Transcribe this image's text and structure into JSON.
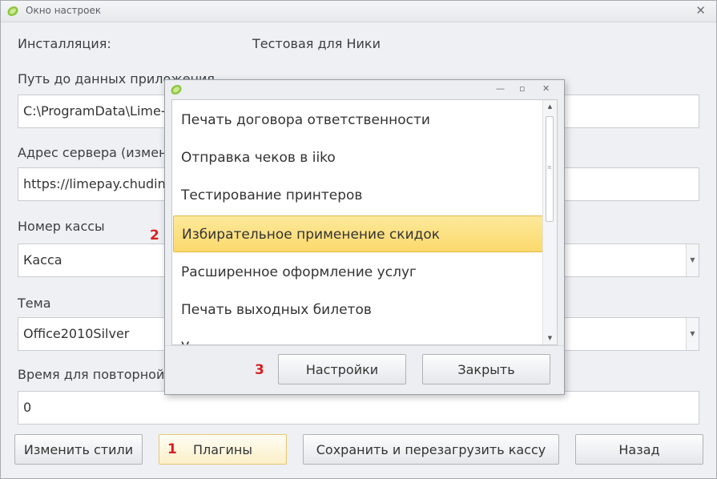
{
  "window": {
    "title": "Окно настроек",
    "close_glyph": "✕"
  },
  "form": {
    "install_label": "Инсталляция:",
    "install_value": "Тестовая для Ники",
    "path_label": "Путь до данных приложения",
    "path_value": "C:\\ProgramData\\Lime-",
    "server_label": "Адрес сервера (измен",
    "server_value": "https://limepay.chudin",
    "register_label": "Номер кассы",
    "register_value": "Касса",
    "theme_label": "Тема",
    "theme_value": "Office2010Silver",
    "retry_label": "Время для повторной",
    "retry_value": "0"
  },
  "buttons": {
    "change_styles": "Изменить стили",
    "plugins": "Плагины",
    "save_restart": "Сохранить и перезагрузить кассу",
    "back": "Назад"
  },
  "annotations": {
    "n1": "1",
    "n2": "2",
    "n3": "3"
  },
  "plugins_dialog": {
    "controls": {
      "minimize": "—",
      "maximize": "▫",
      "close": "✕"
    },
    "items": [
      "Печать договора ответственности",
      "Отправка чеков в iiko",
      "Тестирование принтеров",
      "Избирательное применение скидок",
      "Расширенное оформление услуг",
      "Печать выходных билетов",
      "У"
    ],
    "selected_index": 3,
    "settings_button": "Настройки",
    "close_button": "Закрыть"
  },
  "icons": {
    "app_logo": "lime-logo-icon",
    "dropdown": "chevron-down-icon"
  },
  "colors": {
    "accent_selection": "#fbd96c",
    "annotation": "#d92020",
    "app_logo": "#8cc63f"
  }
}
